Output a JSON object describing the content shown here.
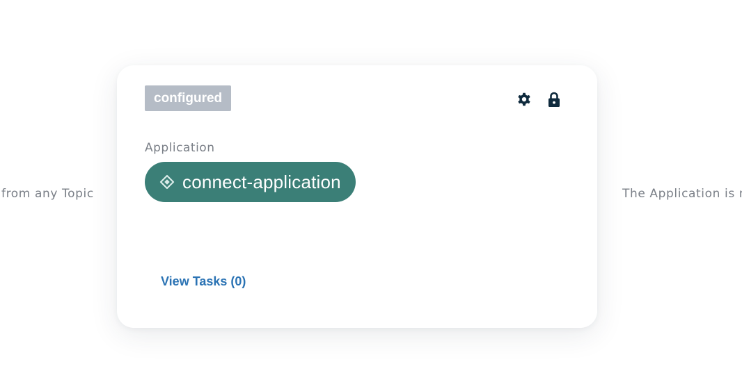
{
  "background_text": {
    "left": "from any Topic",
    "right": "The Application is n"
  },
  "card": {
    "status_badge": "configured",
    "icons": {
      "settings": "gear-icon",
      "lock": "lock-icon",
      "application": "diamond-icon"
    },
    "section_label": "Application",
    "application_name": "connect-application",
    "view_tasks_label": "View Tasks (0)"
  },
  "colors": {
    "badge_background": "#b5bcc6",
    "pill_background": "#3b7f77",
    "link": "#2b73b4",
    "icon": "#0f2a3d",
    "muted_text": "#7a7f87"
  }
}
